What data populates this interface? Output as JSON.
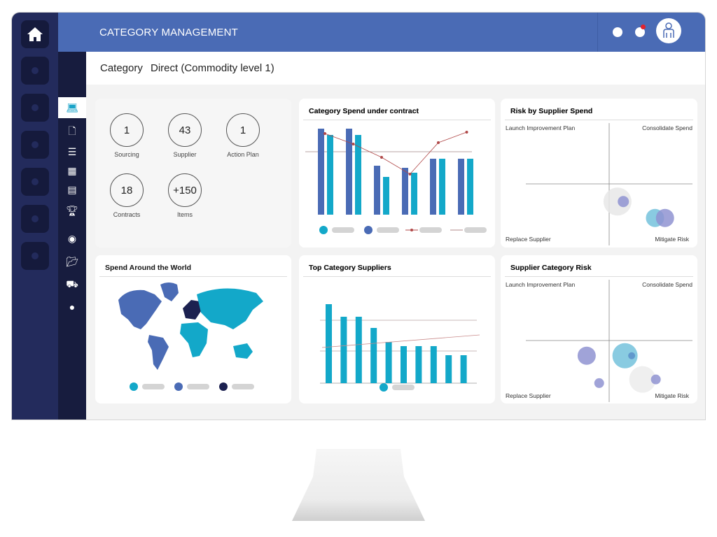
{
  "header": {
    "title": "CATEGORY MANAGEMENT",
    "notification_dot_color": "#e0232e"
  },
  "category": {
    "label": "Category",
    "value": "Direct (Commodity level 1)"
  },
  "stats": [
    {
      "value": "1",
      "label": "Sourcing"
    },
    {
      "value": "43",
      "label": "Supplier"
    },
    {
      "value": "1",
      "label": "Action Plan"
    },
    {
      "value": "18",
      "label": "Contracts"
    },
    {
      "value": "+150",
      "label": "Items"
    }
  ],
  "nav_icons": [
    "laptop-icon",
    "documents-icon",
    "list-icon",
    "calendar-icon",
    "money-icon",
    "trophy-icon",
    "binoculars-icon",
    "folder-icon",
    "truck-icon",
    "chat-icon"
  ],
  "cards": {
    "spend_contract": "Category Spend under contract",
    "risk_spend": "Risk by Supplier Spend",
    "world": "Spend Around the World",
    "top_suppliers": "Top Category Suppliers",
    "supplier_risk": "Supplier Category Risk"
  },
  "quadrants": {
    "tl": "Launch Improvement Plan",
    "tr": "Consolidate Spend",
    "bl": "Replace Supplier",
    "br": "Mitigate Risk"
  },
  "colors": {
    "blue": "#4a6bb5",
    "teal": "#13a8c9",
    "navy": "#1c2150",
    "line": "#b04848",
    "purple": "#8f93d1"
  },
  "chart_data": [
    {
      "type": "bar",
      "title": "Category Spend under contract",
      "ylim": [
        0,
        136
      ],
      "series": [
        {
          "values": [
            123,
            123,
            70,
            67,
            80,
            80
          ]
        },
        {
          "values": [
            114,
            114,
            54,
            60,
            80,
            80
          ]
        },
        {
          "type": "line",
          "values": [
            116,
            101,
            82,
            58,
            103,
            118
          ]
        }
      ],
      "reference_line": 90,
      "grid": false
    },
    {
      "type": "bar",
      "title": "Top Category Suppliers",
      "ylim": [
        0,
        120
      ],
      "values": [
        113,
        95,
        95,
        79,
        59,
        53,
        53,
        53,
        40,
        40
      ],
      "trend": [
        51,
        69
      ],
      "gridlines": [
        0,
        46,
        90
      ]
    },
    {
      "type": "scatter",
      "title": "Risk by Supplier Spend",
      "xlim": [
        -1,
        1
      ],
      "ylim": [
        -1,
        1
      ],
      "points": [
        {
          "x": 0.1,
          "y": -0.29,
          "r": 20,
          "color": "#e8e8e8"
        },
        {
          "x": 0.17,
          "y": -0.29,
          "r": 8,
          "color": "#8f93d1"
        },
        {
          "x": 0.55,
          "y": -0.56,
          "r": 13,
          "color": "#74c2dc"
        },
        {
          "x": 0.67,
          "y": -0.56,
          "r": 13,
          "color": "#8f93d1"
        }
      ]
    },
    {
      "type": "scatter",
      "title": "Supplier Category Risk",
      "xlim": [
        -1,
        1
      ],
      "ylim": [
        -1,
        1
      ],
      "points": [
        {
          "x": -0.27,
          "y": -0.25,
          "r": 13,
          "color": "#8f93d1"
        },
        {
          "x": 0.19,
          "y": -0.25,
          "r": 18,
          "color": "#74c2dc"
        },
        {
          "x": 0.27,
          "y": -0.25,
          "r": 5,
          "color": "#5b8fc9"
        },
        {
          "x": 0.4,
          "y": -0.64,
          "r": 19,
          "color": "#ececec"
        },
        {
          "x": 0.56,
          "y": -0.64,
          "r": 7,
          "color": "#8f93d1"
        },
        {
          "x": -0.12,
          "y": -0.7,
          "r": 7,
          "color": "#8f93d1"
        }
      ]
    }
  ]
}
